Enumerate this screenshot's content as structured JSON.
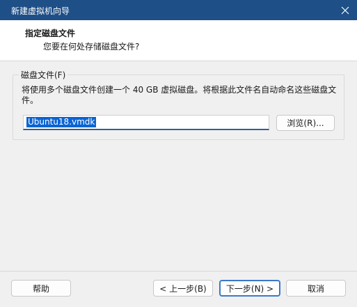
{
  "window": {
    "title": "新建虚拟机向导"
  },
  "header": {
    "title": "指定磁盘文件",
    "subtitle": "您要在何处存储磁盘文件?"
  },
  "disk_group": {
    "legend": "磁盘文件(F)",
    "description": "将使用多个磁盘文件创建一个 40 GB 虚拟磁盘。将根据此文件名自动命名这些磁盘文件。",
    "file_value": "Ubuntu18.vmdk",
    "browse_label": "浏览(R)..."
  },
  "footer": {
    "help_label": "帮助",
    "back_label": "< 上一步(B)",
    "next_label": "下一步(N) >",
    "cancel_label": "取消"
  },
  "icons": {
    "close": "close-icon"
  },
  "colors": {
    "titlebar": "#1e4f86",
    "selection": "#0a64d3",
    "focus": "#3a78c9"
  }
}
